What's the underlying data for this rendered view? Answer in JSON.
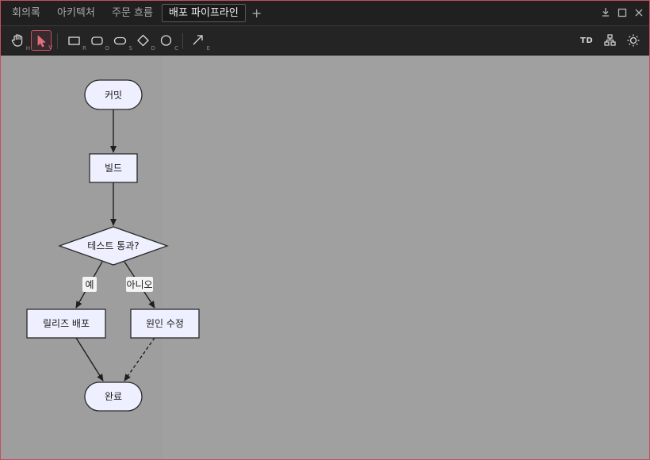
{
  "tabs": [
    {
      "label": "회의록",
      "active": false
    },
    {
      "label": "아키텍처",
      "active": false
    },
    {
      "label": "주문 흐름",
      "active": false
    },
    {
      "label": "배포 파이프라인",
      "active": true
    }
  ],
  "tab_add_label": "+",
  "window_controls": [
    "download-icon",
    "maximize-icon",
    "close-icon"
  ],
  "toolbar": {
    "tools": [
      {
        "name": "hand-tool",
        "icon": "hand-icon",
        "key": "H",
        "active": false
      },
      {
        "name": "select-tool",
        "icon": "cursor-icon",
        "key": "V",
        "active": true
      },
      {
        "name": "rectangle-tool",
        "icon": "rectangle-icon",
        "key": "R",
        "active": false
      },
      {
        "name": "rounded-rect-tool",
        "icon": "rounded-rect-icon",
        "key": "O",
        "active": false
      },
      {
        "name": "stadium-tool",
        "icon": "stadium-icon",
        "key": "S",
        "active": false
      },
      {
        "name": "diamond-tool",
        "icon": "diamond-icon",
        "key": "D",
        "active": false
      },
      {
        "name": "circle-tool",
        "icon": "circle-icon",
        "key": "C",
        "active": false
      },
      {
        "name": "edge-tool",
        "icon": "arrow-icon",
        "key": "E",
        "active": false
      }
    ],
    "direction_label": "TD",
    "right_icons": [
      "layout-tree-icon",
      "sun-icon"
    ]
  },
  "colors": {
    "accent": "#c25260",
    "node_fill": "#eef0ff",
    "node_stroke": "#2a2a2a",
    "canvas": "#a0a0a0"
  },
  "flowchart": {
    "nodes": [
      {
        "id": "commit",
        "label": "커밋",
        "shape": "stadium"
      },
      {
        "id": "build",
        "label": "빌드",
        "shape": "rect"
      },
      {
        "id": "test",
        "label": "테스트 통과?",
        "shape": "diamond"
      },
      {
        "id": "release",
        "label": "릴리즈 배포",
        "shape": "rect"
      },
      {
        "id": "fix",
        "label": "원인 수정",
        "shape": "rect"
      },
      {
        "id": "done",
        "label": "완료",
        "shape": "stadium"
      }
    ],
    "edges": [
      {
        "from": "commit",
        "to": "build",
        "label": "",
        "style": "solid"
      },
      {
        "from": "build",
        "to": "test",
        "label": "",
        "style": "solid"
      },
      {
        "from": "test",
        "to": "release",
        "label": "예",
        "style": "solid"
      },
      {
        "from": "test",
        "to": "fix",
        "label": "아니오",
        "style": "solid"
      },
      {
        "from": "release",
        "to": "done",
        "label": "",
        "style": "solid"
      },
      {
        "from": "fix",
        "to": "done",
        "label": "",
        "style": "dashed"
      }
    ]
  }
}
